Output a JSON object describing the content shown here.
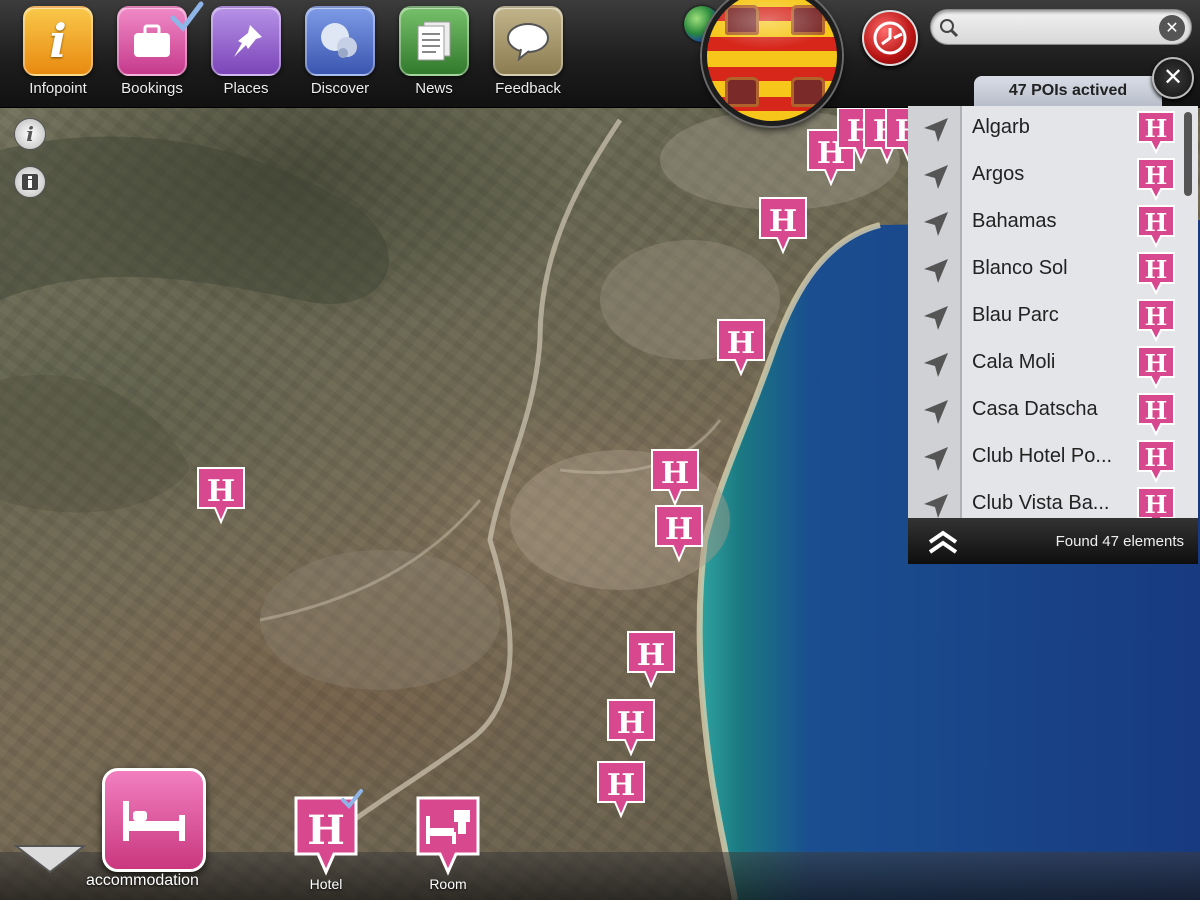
{
  "toolbar": {
    "items": [
      {
        "label": "Infopoint",
        "icon": "info-icon",
        "color": "#f0a020"
      },
      {
        "label": "Bookings",
        "icon": "suitcase-icon",
        "color": "#e060a8"
      },
      {
        "label": "Places",
        "icon": "pushpin-icon",
        "color": "#9a6ad0"
      },
      {
        "label": "Discover",
        "icon": "globe-binoculars-icon",
        "color": "#5c78cc"
      },
      {
        "label": "News",
        "icon": "newspaper-icon",
        "color": "#4a9a42"
      },
      {
        "label": "Feedback",
        "icon": "speech-bubble-icon",
        "color": "#a89870"
      }
    ]
  },
  "search": {
    "value": "",
    "placeholder": ""
  },
  "poi_panel": {
    "header": "47 POIs actived",
    "items": [
      {
        "name": "Algarb"
      },
      {
        "name": "Argos"
      },
      {
        "name": "Bahamas"
      },
      {
        "name": "Blanco Sol"
      },
      {
        "name": "Blau Parc"
      },
      {
        "name": "Cala Moli"
      },
      {
        "name": "Casa Datscha"
      },
      {
        "name": "Club Hotel Po..."
      },
      {
        "name": "Club Vista Ba..."
      }
    ],
    "footer": "Found 47 elements"
  },
  "map": {
    "marker_letter": "H",
    "sea_color": "#1d3f86",
    "marker_color": "#d8488e"
  },
  "bottom": {
    "category_label": "accommodation",
    "sub_items": [
      {
        "label": "Hotel",
        "icon": "hotel-h-icon"
      },
      {
        "label": "Room",
        "icon": "room-bed-icon"
      }
    ]
  }
}
